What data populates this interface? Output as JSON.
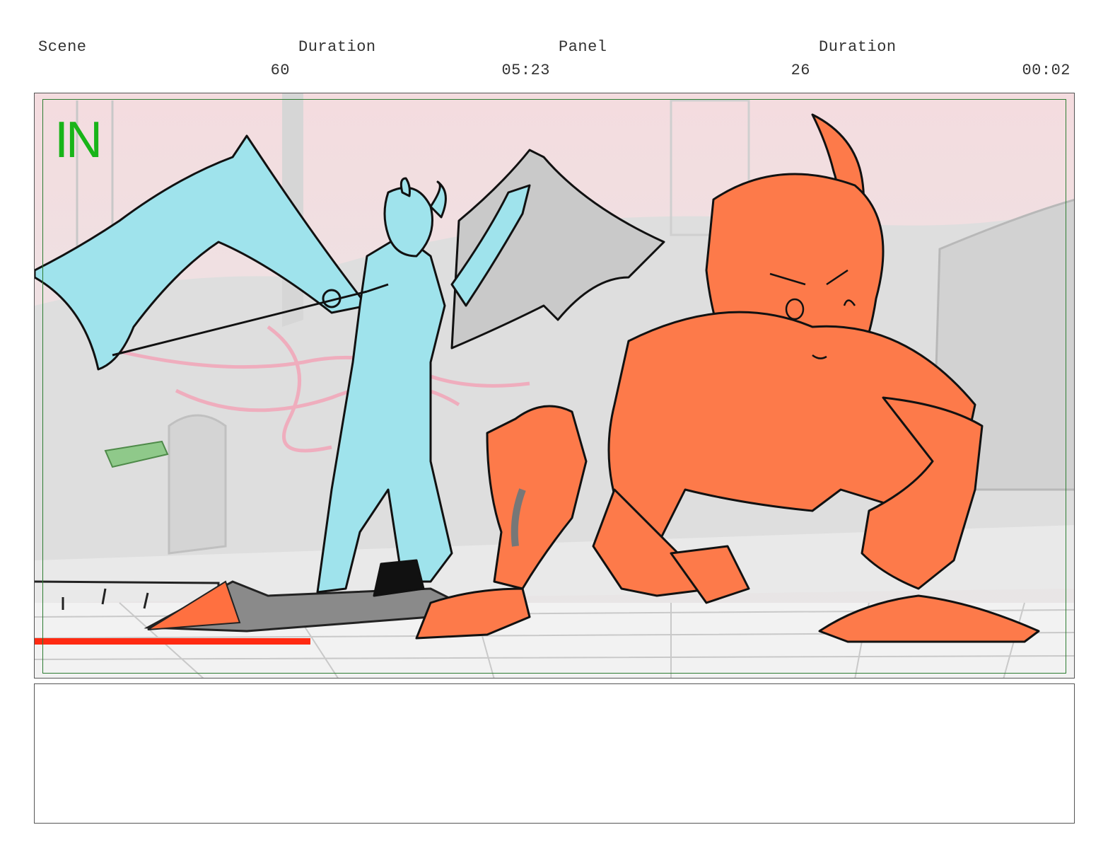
{
  "header": {
    "scene_label": "Scene",
    "scene_duration_label": "Duration",
    "panel_label": "Panel",
    "panel_duration_label": "Duration",
    "scene_value": "60",
    "scene_duration_value": "05:23",
    "panel_value": "26",
    "panel_duration_value": "00:02"
  },
  "panel": {
    "transition_marker": "IN",
    "marker_color": "#19b419",
    "safe_frame_color": "#2e7d32"
  },
  "notes": {
    "text": ""
  }
}
